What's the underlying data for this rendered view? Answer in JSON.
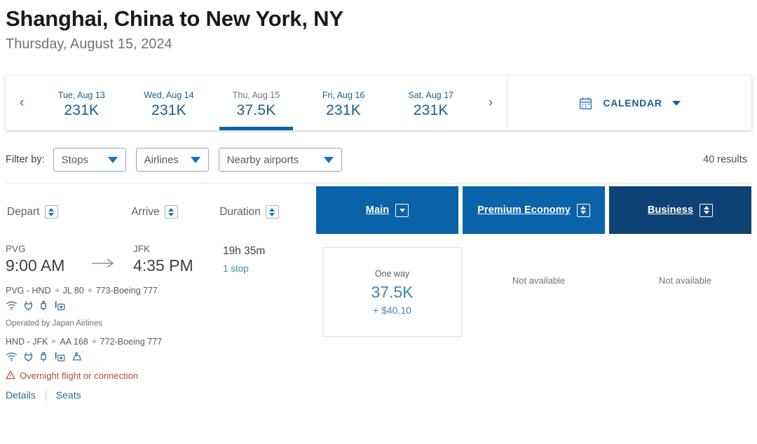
{
  "header": {
    "route_title": "Shanghai, China to New York, NY",
    "date_subtitle": "Thursday, August 15, 2024"
  },
  "date_strip": {
    "prev_arrow": "‹",
    "next_arrow": "›",
    "dates": [
      {
        "label": "Tue, Aug 13",
        "price": "231K",
        "selected": false
      },
      {
        "label": "Wed, Aug 14",
        "price": "231K",
        "selected": false
      },
      {
        "label": "Thu, Aug 15",
        "price": "37.5K",
        "selected": true
      },
      {
        "label": "Fri, Aug 16",
        "price": "231K",
        "selected": false
      },
      {
        "label": "Sat, Aug 17",
        "price": "231K",
        "selected": false
      }
    ],
    "calendar_label": "CALENDAR",
    "calendar_icon": "calendar-icon"
  },
  "filters": {
    "label": "Filter by:",
    "buttons": [
      {
        "label": "Stops"
      },
      {
        "label": "Airlines"
      },
      {
        "label": "Nearby airports"
      }
    ],
    "results_count": "40 results"
  },
  "columns": {
    "depart": "Depart",
    "arrive": "Arrive",
    "duration": "Duration"
  },
  "fare_tabs": [
    {
      "label": "Main",
      "sort": "down"
    },
    {
      "label": "Premium Economy",
      "sort": "both"
    },
    {
      "label": "Business",
      "sort": "both"
    }
  ],
  "flight": {
    "depart_airport": "PVG",
    "depart_time": "9:00 AM",
    "arrive_airport": "JFK",
    "arrive_time": "4:35 PM",
    "duration": "19h 35m",
    "stops": "1 stop",
    "segments": [
      {
        "route": "PVG - HND",
        "flight_number": "JL 80",
        "aircraft": "773-Boeing 777",
        "amenities": [
          "wifi-icon",
          "power-icon",
          "usb-icon",
          "entertainment-icon"
        ]
      },
      {
        "route": "HND - JFK",
        "flight_number": "AA 168",
        "aircraft": "772-Boeing 777",
        "amenities": [
          "wifi-icon",
          "power-icon",
          "usb-icon",
          "entertainment-icon",
          "lieflat-seat-icon"
        ]
      }
    ],
    "operated_by": "Operated by Japan Airlines",
    "overnight_notice": "Overnight flight or connection",
    "details_link": "Details",
    "seats_link": "Seats",
    "fares": [
      {
        "available": true,
        "one_way_label": "One way",
        "price": "37.5K",
        "taxes": "+ $40.10"
      },
      {
        "available": false,
        "unavailable_label": "Not available"
      },
      {
        "available": false,
        "unavailable_label": "Not available"
      }
    ]
  },
  "colors": {
    "accent_blue": "#0a62a9",
    "dark_navy": "#0f4274",
    "link_blue": "#3e87b8",
    "warning_red": "#b14a3c"
  }
}
